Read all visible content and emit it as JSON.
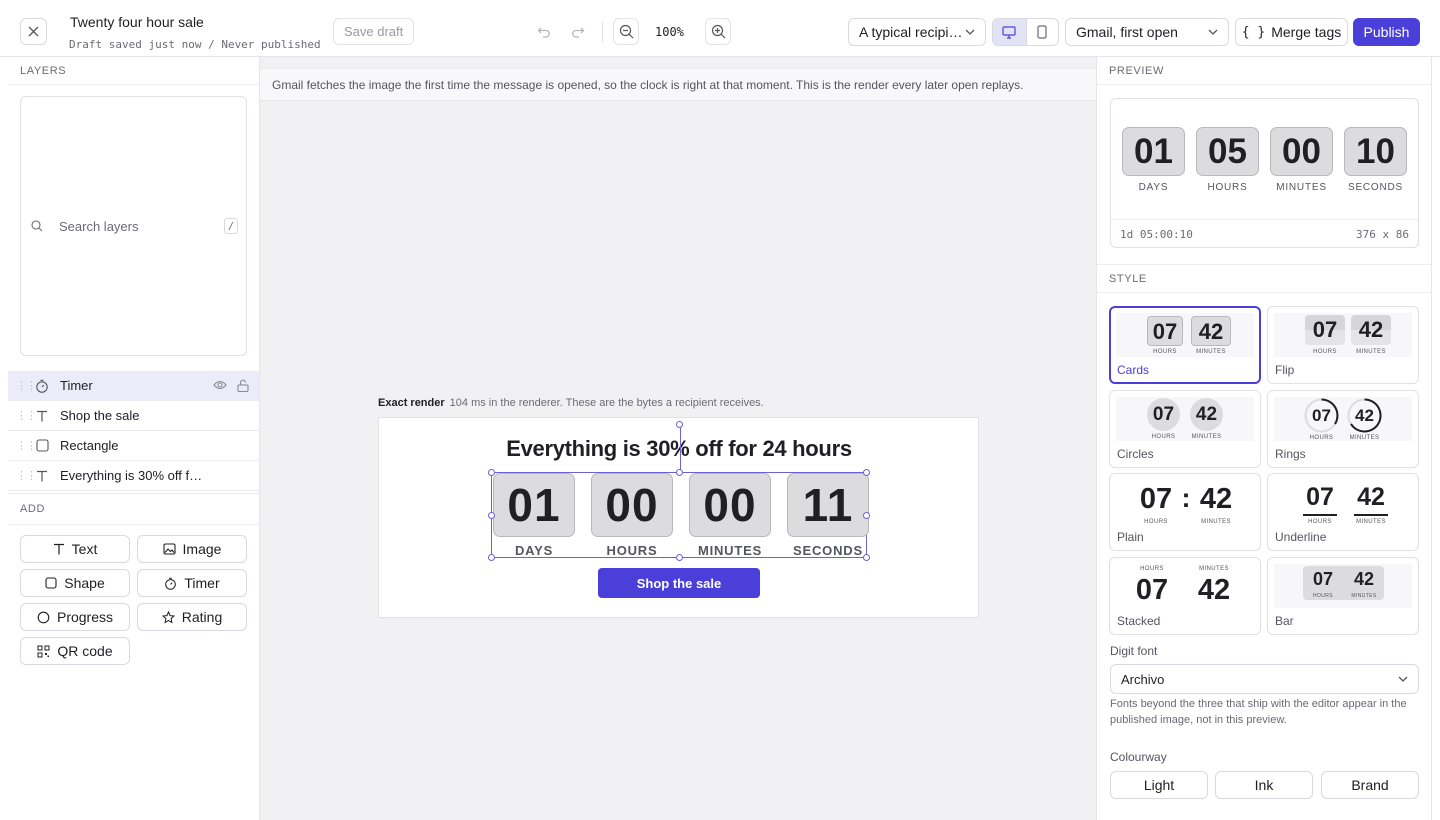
{
  "topbar": {
    "title": "Twenty four hour sale",
    "subtitle": "Draft saved just now / Never published",
    "save_draft": "Save draft",
    "zoom": "100%",
    "recipient": "A typical recipi…",
    "client": "Gmail, first open",
    "merge_tags": "Merge tags",
    "publish": "Publish"
  },
  "layers": {
    "heading": "LAYERS",
    "search_placeholder": "Search layers",
    "shortcut": "/",
    "items": [
      {
        "label": "Timer",
        "icon": "timer-icon",
        "selected": true
      },
      {
        "label": "Shop the sale",
        "icon": "text-icon"
      },
      {
        "label": "Rectangle",
        "icon": "rectangle-icon"
      },
      {
        "label": "Everything is 30% off f…",
        "icon": "text-icon"
      }
    ]
  },
  "add": {
    "heading": "ADD",
    "buttons": [
      "Text",
      "Image",
      "Shape",
      "Timer",
      "Progress",
      "Rating",
      "QR code"
    ]
  },
  "canvas": {
    "info": "Gmail fetches the image the first time the message is opened, so the clock is right at that moment. This is the render every later open replays.",
    "render_title": "Exact render",
    "render_note": "104 ms in the renderer. These are the bytes a recipient receives.",
    "headline": "Everything is 30% off for 24 hours",
    "timer": [
      {
        "value": "01",
        "label": "DAYS"
      },
      {
        "value": "00",
        "label": "HOURS"
      },
      {
        "value": "00",
        "label": "MINUTES"
      },
      {
        "value": "11",
        "label": "SECONDS"
      }
    ],
    "button": "Shop the sale"
  },
  "preview": {
    "heading": "PREVIEW",
    "timer": [
      {
        "value": "01",
        "label": "DAYS"
      },
      {
        "value": "05",
        "label": "HOURS"
      },
      {
        "value": "00",
        "label": "MINUTES"
      },
      {
        "value": "10",
        "label": "SECONDS"
      }
    ],
    "remaining": "1d 05:00:10",
    "dimensions": "376 x 86"
  },
  "style": {
    "heading": "STYLE",
    "sample_hours": "07",
    "sample_minutes": "42",
    "sample_hours_label": "HOURS",
    "sample_minutes_label": "MINUTES",
    "tiles": [
      "Cards",
      "Flip",
      "Circles",
      "Rings",
      "Plain",
      "Underline",
      "Stacked",
      "Bar"
    ],
    "selected": "Cards",
    "digit_font_label": "Digit font",
    "digit_font": "Archivo",
    "font_hint": "Fonts beyond the three that ship with the editor appear in the published image, not in this preview.",
    "colourway_label": "Colourway",
    "colourways": [
      "Light",
      "Ink",
      "Brand"
    ]
  },
  "colors": {
    "accent": "#4b3fd9",
    "selection": "#6b61d6"
  }
}
